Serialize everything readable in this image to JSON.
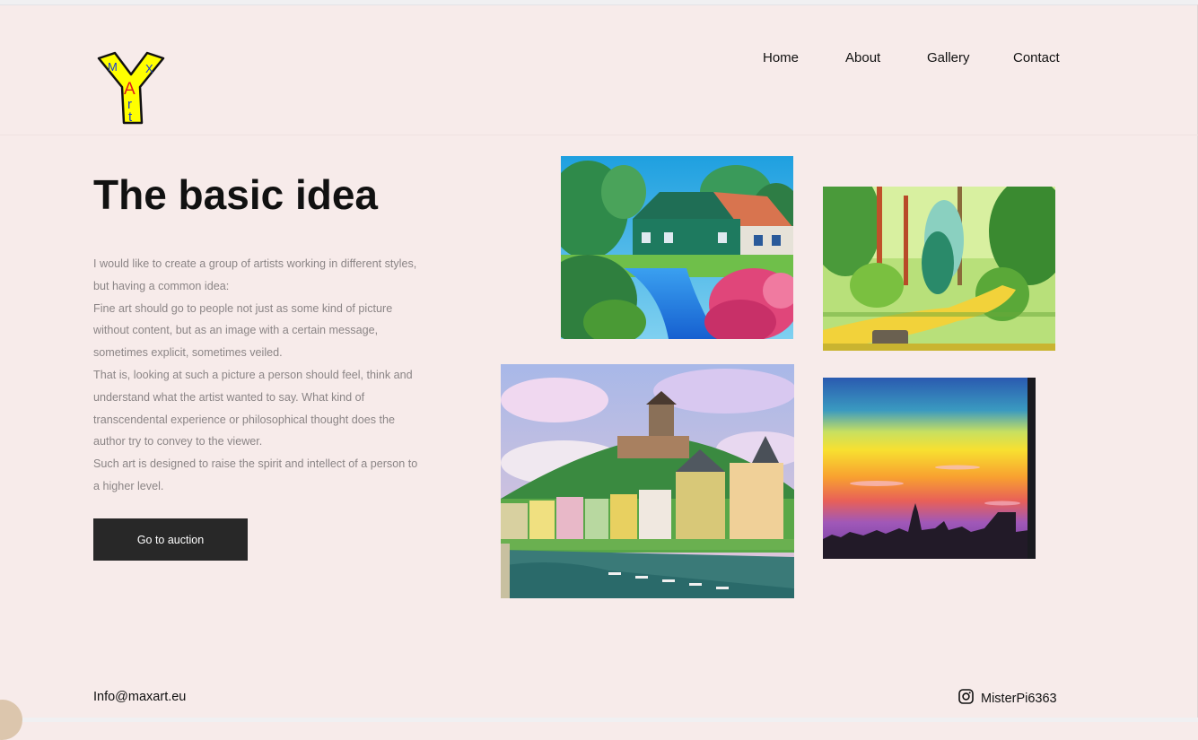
{
  "brand": {
    "logo_letters": [
      "M",
      "X",
      "A",
      "r",
      "t"
    ],
    "colors": {
      "logo_yellow": "#ffff00",
      "logo_blue": "#1a3ccf",
      "logo_red": "#e0191c"
    }
  },
  "nav": {
    "items": [
      "Home",
      "About",
      "Gallery",
      "Contact"
    ]
  },
  "hero": {
    "title": "The basic idea",
    "paragraphs": [
      "I would like to create a group of artists working in different styles, but having a common idea:",
      "Fine art should go to people not just as some kind of picture without content, but as an image with a certain message, sometimes explicit, sometimes veiled.",
      "That is, looking at such a picture a person should feel, think and understand what the artist wanted to say. What kind of transcendental experience or philosophical thought does the author try to convey to the viewer.",
      "Such art is designed to raise the spirit and intellect of a person to a higher level."
    ],
    "button_label": "Go to auction"
  },
  "gallery": [
    {
      "name": "painting-green-house-canal"
    },
    {
      "name": "painting-forest-path"
    },
    {
      "name": "painting-hilltop-castle-town"
    },
    {
      "name": "painting-sunset-skyline"
    }
  ],
  "footer": {
    "email": "Info@maxart.eu",
    "instagram_icon": "instagram-icon",
    "instagram_handle": "MisterPi6363"
  },
  "colors": {
    "background": "#f7ebea",
    "button_bg": "#282828",
    "text_muted": "#8b8586"
  }
}
